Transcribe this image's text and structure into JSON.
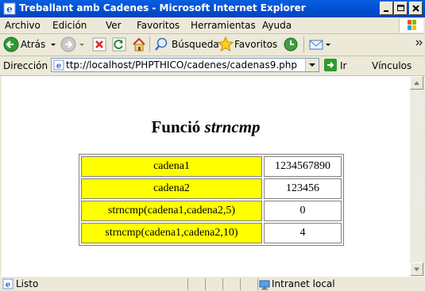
{
  "window": {
    "title": "Treballant amb Cadenes - Microsoft Internet Explorer"
  },
  "menu": {
    "items": [
      "Archivo",
      "Edición",
      "Ver",
      "Favoritos",
      "Herramientas",
      "Ayuda"
    ]
  },
  "toolbar": {
    "back_label": "Atrás",
    "search_label": "Búsqueda",
    "favorites_label": "Favoritos"
  },
  "address": {
    "label": "Dirección",
    "value": "ttp://localhost/PHPTHICO/cadenes/cadenas9.php",
    "go_label": "Ir",
    "links_label": "Vínculos"
  },
  "page": {
    "heading_prefix": "Funció",
    "heading_fn": "strncmp",
    "rows": [
      {
        "label": "cadena1",
        "value": "1234567890"
      },
      {
        "label": "cadena2",
        "value": "123456"
      },
      {
        "label": "strncmp(cadena1,cadena2,5)",
        "value": "0"
      },
      {
        "label": "strncmp(cadena1,cadena2,10)",
        "value": "4"
      }
    ]
  },
  "status": {
    "text": "Listo",
    "zone": "Intranet local"
  },
  "colors": {
    "titlebar": "#0054e3",
    "key_cell_bg": "#ffff00",
    "chrome": "#ece9d8"
  }
}
